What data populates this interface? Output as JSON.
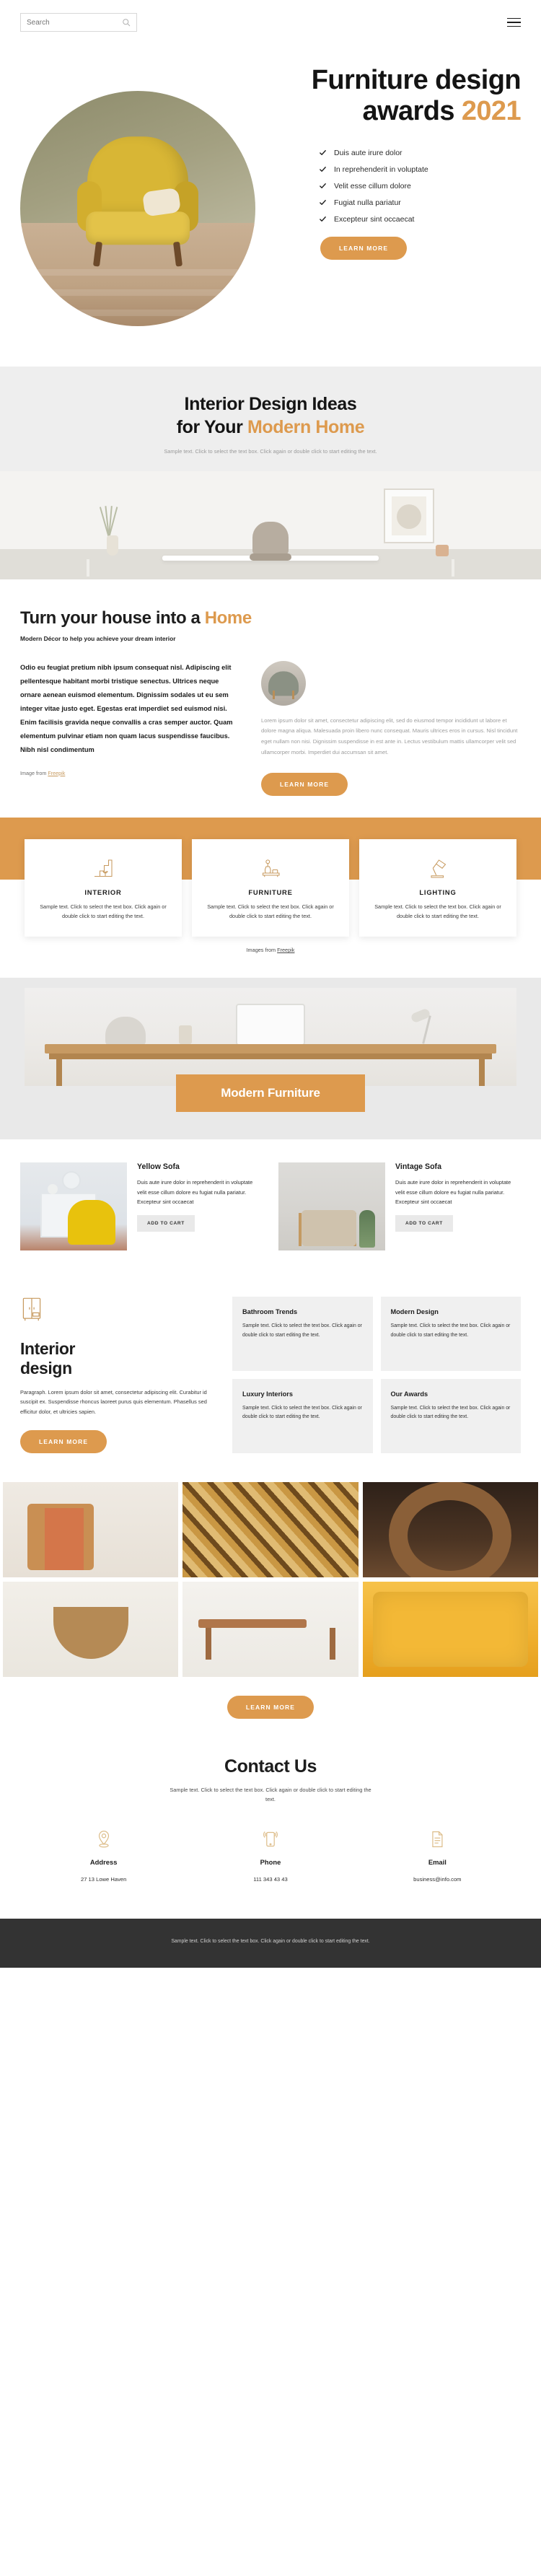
{
  "topbar": {
    "search_placeholder": "Search",
    "search_value": "",
    "search_icon": "search-icon",
    "menu_icon": "hamburger-menu-icon"
  },
  "hero": {
    "title_line1": "Furniture design",
    "title_line2_main": "awards ",
    "title_line2_accent": "2021",
    "checklist": [
      "Duis aute irure dolor",
      "In reprehenderit in voluptate",
      "Velit esse cillum dolore",
      "Fugiat nulla pariatur",
      "Excepteur sint occaecat"
    ],
    "cta_label": "LEARN MORE"
  },
  "ideas": {
    "title_line1": "Interior Design Ideas",
    "title_line2_main": "for Your ",
    "title_line2_accent": "Modern Home",
    "subtitle": "Sample text. Click to select the text box. Click again or double click to start editing the text."
  },
  "turn": {
    "title_main": "Turn your house into a ",
    "title_accent": "Home",
    "tagline": "Modern Décor to help you achieve your dream interior",
    "body_bold": "Odio eu feugiat pretium nibh ipsum consequat nisl. Adipiscing elit pellentesque habitant morbi tristique senectus. Ultrices neque ornare aenean euismod elementum. Dignissim sodales ut eu sem integer vitae justo eget. Egestas erat imperdiet sed euismod nisi. Enim facilisis gravida neque convallis a cras semper auctor. Quam elementum pulvinar etiam non quam lacus suspendisse faucibus. Nibh nisl condimentum",
    "credit_prefix": "Image from ",
    "credit_link": "Freepik",
    "body_light": "Lorem ipsum dolor sit amet, consectetur adipiscing elit, sed do eiusmod tempor incididunt ut labore et dolore magna aliqua. Malesuada proin libero nunc consequat. Mauris ultrices eros in cursus. Nisl tincidunt eget nullam non nisi. Dignissim suspendisse in est ante in. Lectus vestibulum mattis ullamcorper velit sed ullamcorper morbi. Imperdiet dui accumsan sit amet.",
    "cta_label": "LEARN MORE"
  },
  "features": {
    "cards": [
      {
        "title": "INTERIOR",
        "icon": "stairs-plant-icon",
        "text": "Sample text. Click to select the text box. Click again or double click to start editing the text."
      },
      {
        "title": "FURNITURE",
        "icon": "vase-sideboard-icon",
        "text": "Sample text. Click to select the text box. Click again or double click to start editing the text."
      },
      {
        "title": "LIGHTING",
        "icon": "desk-lamp-icon",
        "text": "Sample text. Click to select the text box. Click again or double click to start editing the text."
      }
    ],
    "credit_prefix": "Images from ",
    "credit_link": "Freepik"
  },
  "banner": {
    "label": "Modern Furniture"
  },
  "products": [
    {
      "title": "Yellow Sofa",
      "text": "Duis aute irure dolor in reprehenderit in voluptate velit esse cillum dolore eu fugiat nulla pariatur. Excepteur sint occaecat",
      "button": "ADD TO CART"
    },
    {
      "title": "Vintage Sofa",
      "text": "Duis aute irure dolor in reprehenderit in voluptate velit esse cillum dolore eu fugiat nulla pariatur. Excepteur sint occaecat",
      "button": "ADD TO CART"
    }
  ],
  "interior_design": {
    "icon": "wardrobe-icon",
    "title_line1": "Interior",
    "title_line2": "design",
    "paragraph": "Paragraph. Lorem ipsum dolor sit amet, consectetur adipiscing elit. Curabitur id suscipit ex. Suspendisse rhoncus laoreet purus quis elementum. Phasellus sed efficitur dolor, et ultricies sapien.",
    "cta_label": "LEARN MORE",
    "cards": [
      {
        "title": "Bathroom Trends",
        "text": "Sample text. Click to select the text box. Click again or double click to start editing the text."
      },
      {
        "title": "Modern Design",
        "text": "Sample text. Click to select the text box. Click again or double click to start editing the text."
      },
      {
        "title": "Luxury Interiors",
        "text": "Sample text. Click to select the text box. Click again or double click to start editing the text."
      },
      {
        "title": "Our Awards",
        "text": "Sample text. Click to select the text box. Click again or double click to start editing the text."
      }
    ]
  },
  "gallery": {
    "cta_label": "LEARN MORE",
    "tiles": [
      "chair-with-throw-photo",
      "leopard-print-photo",
      "woven-rattan-photo",
      "rattan-bowl-photo",
      "wooden-bench-photo",
      "yellow-cushion-photo"
    ]
  },
  "contact": {
    "title": "Contact Us",
    "subtitle": "Sample text. Click to select the text box. Click again or double click to start editing the text.",
    "items": [
      {
        "icon": "location-pin-icon",
        "label": "Address",
        "value": "27 13 Lowe Haven"
      },
      {
        "icon": "phone-icon",
        "label": "Phone",
        "value": "111 343 43 43"
      },
      {
        "icon": "document-icon",
        "label": "Email",
        "value": "business@info.com"
      }
    ]
  },
  "footer": {
    "text": "Sample text. Click to select the text box. Click again or double click to start editing the text."
  },
  "colors": {
    "accent": "#dd9a4e",
    "dark": "#333333",
    "band": "#eeeeee"
  }
}
